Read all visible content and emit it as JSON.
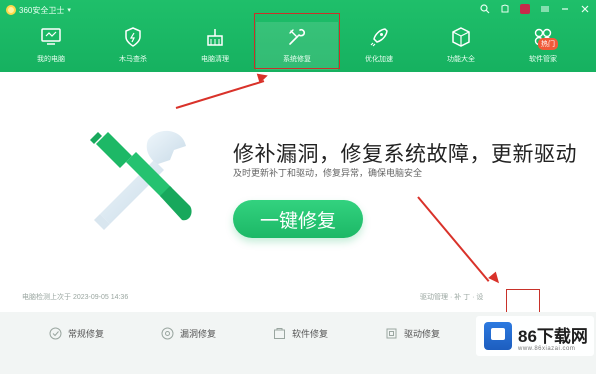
{
  "app": {
    "title": "360安全卫士 ",
    "chevron": "▾",
    "accent": "#1db866",
    "icons": [
      "search-icon",
      "skin-icon",
      "message-icon",
      "minimize-icon",
      "close-icon"
    ]
  },
  "nav": {
    "tabs": [
      {
        "label": "我的电脑",
        "icon": "monitor-icon",
        "active": false
      },
      {
        "label": "木马查杀",
        "icon": "shield-icon",
        "active": false
      },
      {
        "label": "电脑清理",
        "icon": "broom-icon",
        "active": false
      },
      {
        "label": "系统修复",
        "icon": "wrench-icon",
        "active": true
      },
      {
        "label": "优化加速",
        "icon": "rocket-icon",
        "active": false
      },
      {
        "label": "功能大全",
        "icon": "box-icon",
        "active": false
      },
      {
        "label": "软件管家",
        "icon": "apps-icon",
        "active": false
      }
    ],
    "hot_badge": "热门"
  },
  "hero": {
    "title": "修补漏洞，修复系统故障，更新驱动",
    "subtitle": "及时更新补丁和驱动，修复异常，确保电脑安全",
    "button_label": "一键修复"
  },
  "status": {
    "left": "电脑检测上次于 2023-09-05 14:36",
    "right": "驱动管理 · 补 丁 · 设"
  },
  "bottom_tabs": [
    {
      "label": "常规修复",
      "icon": "check-circle-icon"
    },
    {
      "label": "漏洞修复",
      "icon": "bug-icon"
    },
    {
      "label": "软件修复",
      "icon": "package-icon"
    },
    {
      "label": "驱动修复",
      "icon": "chip-icon"
    }
  ],
  "watermark": {
    "text": "86下载网",
    "sub": "www.86xiazai.com"
  }
}
